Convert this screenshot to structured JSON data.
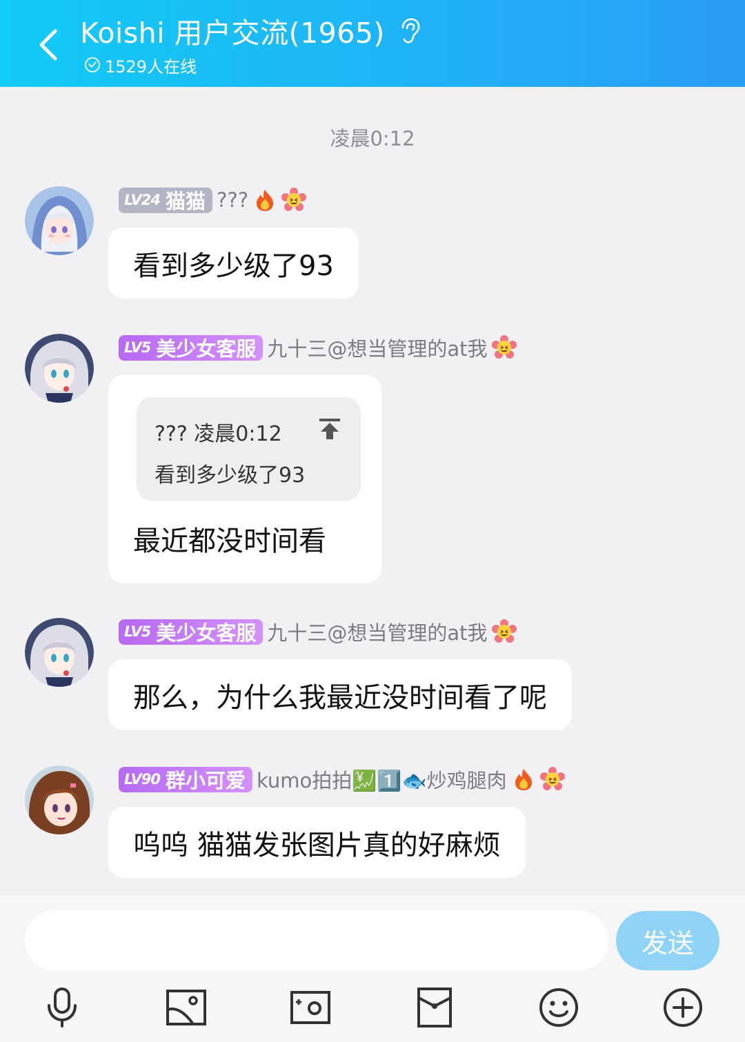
{
  "header": {
    "title": "Koishi 用户交流(1965)",
    "online": "1529人在线",
    "back_icon": "chevron-left-icon",
    "listen_icon": "ear-icon"
  },
  "timestamp": "凌晨0:12",
  "messages": [
    {
      "level": "LV24",
      "title": "猫猫",
      "badge_style": "gray",
      "nick": "???",
      "emojis": [
        "fire",
        "flower-face"
      ],
      "text": "看到多少级了93"
    },
    {
      "level": "LV5",
      "title": "美少女客服",
      "badge_style": "purple",
      "nick": "九十三@想当管理的at我",
      "emojis": [
        "flower-face"
      ],
      "quote": {
        "head": "??? 凌晨0:12",
        "body": "看到多少级了93"
      },
      "text": "最近都没时间看"
    },
    {
      "level": "LV5",
      "title": "美少女客服",
      "badge_style": "purple",
      "nick": "九十三@想当管理的at我",
      "emojis": [
        "flower-face"
      ],
      "text": "那么，为什么我最近没时间看了呢"
    },
    {
      "level": "LV90",
      "title": "群小可爱",
      "badge_style": "purple",
      "nick": "kumo拍拍💹1️⃣🐟炒鸡腿肉",
      "emojis": [
        "fire",
        "flower-face"
      ],
      "text": "呜呜 猫猫发张图片真的好麻烦"
    }
  ],
  "input": {
    "placeholder": "",
    "value": ""
  },
  "send_label": "发送",
  "toolbar": [
    "microphone-icon",
    "image-icon",
    "camera-icon",
    "red-packet-icon",
    "emoji-icon",
    "plus-icon"
  ],
  "colors": {
    "header": "#1fb3f6",
    "send": "#8fd3f7",
    "bubble": "#ffffff",
    "background": "#f1f1f3"
  }
}
